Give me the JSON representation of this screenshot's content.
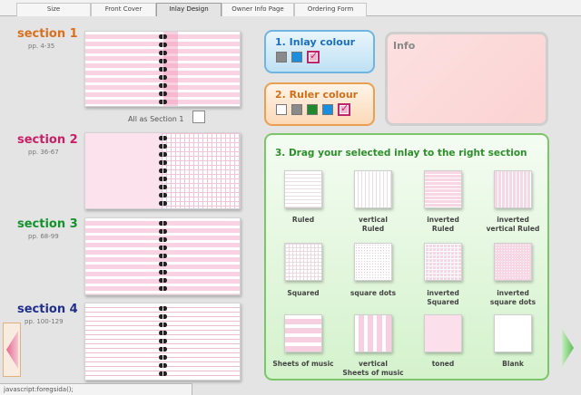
{
  "tabs": [
    {
      "label": "Size"
    },
    {
      "label": "Front Cover"
    },
    {
      "label": "Inlay Design"
    },
    {
      "label": "Owner Info Page"
    },
    {
      "label": "Ordering Form"
    }
  ],
  "sections": [
    {
      "title": "section 1",
      "pages": "pp. 4-35",
      "color": "#d9701f"
    },
    {
      "title": "section 2",
      "pages": "pp. 36-67",
      "color": "#c81f66"
    },
    {
      "title": "section 3",
      "pages": "pp. 68-99",
      "color": "#15912d"
    },
    {
      "title": "section 4",
      "pages": "pp. 100-129",
      "color": "#1f2f8c"
    }
  ],
  "all_as_section": "All as Section 1",
  "inlay_colour": {
    "title": "1. Inlay colour",
    "swatches": [
      {
        "color": "#8a8a8a"
      },
      {
        "color": "#1b8fde"
      },
      {
        "color": "#f4b6cf",
        "selected": true
      }
    ]
  },
  "ruler_colour": {
    "title": "2. Ruler colour",
    "swatches": [
      {
        "color": "#ffffff"
      },
      {
        "color": "#8a8a8a"
      },
      {
        "color": "#1e8a2c"
      },
      {
        "color": "#1b8fde"
      },
      {
        "color": "#f4b6cf",
        "selected": true
      }
    ]
  },
  "info": {
    "title": "Info"
  },
  "drag_panel": {
    "title": "3. Drag your selected inlay to the right section",
    "inlays": [
      {
        "label": "Ruled",
        "icon": "ruled"
      },
      {
        "label": "vertical\nRuled",
        "icon": "vertical-ruled"
      },
      {
        "label": "inverted\nRuled",
        "icon": "inverted-ruled"
      },
      {
        "label": "inverted\nvertical Ruled",
        "icon": "inverted-vertical-ruled"
      },
      {
        "label": "Squared",
        "icon": "squared"
      },
      {
        "label": "square dots",
        "icon": "square-dots"
      },
      {
        "label": "inverted\nSquared",
        "icon": "inverted-squared"
      },
      {
        "label": "inverted\nsquare dots",
        "icon": "inverted-square-dots"
      },
      {
        "label": "Sheets of music",
        "icon": "sheets-of-music"
      },
      {
        "label": "vertical\nSheets of music",
        "icon": "vertical-sheets-of-music"
      },
      {
        "label": "toned",
        "icon": "toned"
      },
      {
        "label": "Blank",
        "icon": "blank"
      }
    ]
  },
  "nav": {
    "prev_icon": "arrow-left-icon",
    "next_icon": "arrow-right-icon"
  },
  "status_bar": "javascript:foregsida();"
}
